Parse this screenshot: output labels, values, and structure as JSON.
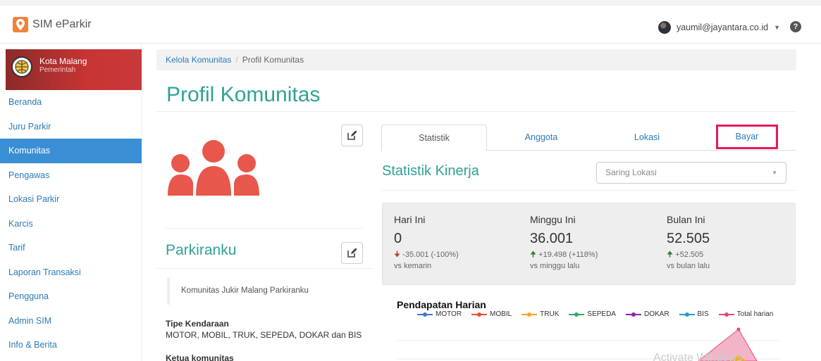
{
  "app": {
    "title": "SIM eParkir"
  },
  "user": {
    "email": "yaumil@jayantara.co.id"
  },
  "org": {
    "name": "Kota Malang",
    "type": "Pemerintah"
  },
  "sidebar": {
    "items": [
      {
        "label": "Beranda"
      },
      {
        "label": "Juru Parkir"
      },
      {
        "label": "Komunitas"
      },
      {
        "label": "Pengawas"
      },
      {
        "label": "Lokasi Parkir"
      },
      {
        "label": "Karcis"
      },
      {
        "label": "Tarif"
      },
      {
        "label": "Laporan Transaksi"
      },
      {
        "label": "Pengguna"
      },
      {
        "label": "Admin SIM"
      },
      {
        "label": "Info & Berita"
      }
    ],
    "active": "Komunitas"
  },
  "breadcrumb": {
    "parent": "Kelola Komunitas",
    "current": "Profil Komunitas"
  },
  "page": {
    "title": "Profil Komunitas"
  },
  "community": {
    "name": "Parkiranku",
    "description": "Komunitas Jukir Malang Parkiranku",
    "vehicle_label": "Tipe Kendaraan",
    "vehicle_value": "MOTOR, MOBIL, TRUK, SEPEDA, DOKAR dan BIS",
    "leader_label": "Ketua komunitas"
  },
  "tabs": [
    {
      "label": "Statistik"
    },
    {
      "label": "Anggota"
    },
    {
      "label": "Lokasi"
    },
    {
      "label": "Bayar"
    }
  ],
  "stats": {
    "title": "Statistik Kinerja",
    "filter_placeholder": "Saring Lokasi",
    "today": {
      "label": "Hari Ini",
      "value": "0",
      "change": "-35.001 (-100%)",
      "compare": "vs kemarin"
    },
    "week": {
      "label": "Minggu Ini",
      "value": "36.001",
      "change": "+19.498 (+118%)",
      "compare": "vs minggu lalu"
    },
    "month": {
      "label": "Bulan Ini",
      "value": "52.505",
      "change": "+52.505",
      "compare": "vs bulan lalu"
    }
  },
  "chart": {
    "title": "Pendapatan Harian",
    "legend": [
      {
        "name": "MOTOR",
        "color": "#3a78c9"
      },
      {
        "name": "MOBIL",
        "color": "#e84d3d"
      },
      {
        "name": "TRUK",
        "color": "#f5a623"
      },
      {
        "name": "SEPEDA",
        "color": "#27ae60"
      },
      {
        "name": "DOKAR",
        "color": "#8e24aa"
      },
      {
        "name": "BIS",
        "color": "#1e9bd7"
      },
      {
        "name": "Total harian",
        "color": "#e8457a"
      }
    ]
  },
  "watermark": "Activate Windows",
  "colors": {
    "accent": "#30a197",
    "link": "#2a7ab8",
    "active_nav": "#3a8ed3",
    "highlight": "#e6185f",
    "people_icon": "#e8574b"
  }
}
